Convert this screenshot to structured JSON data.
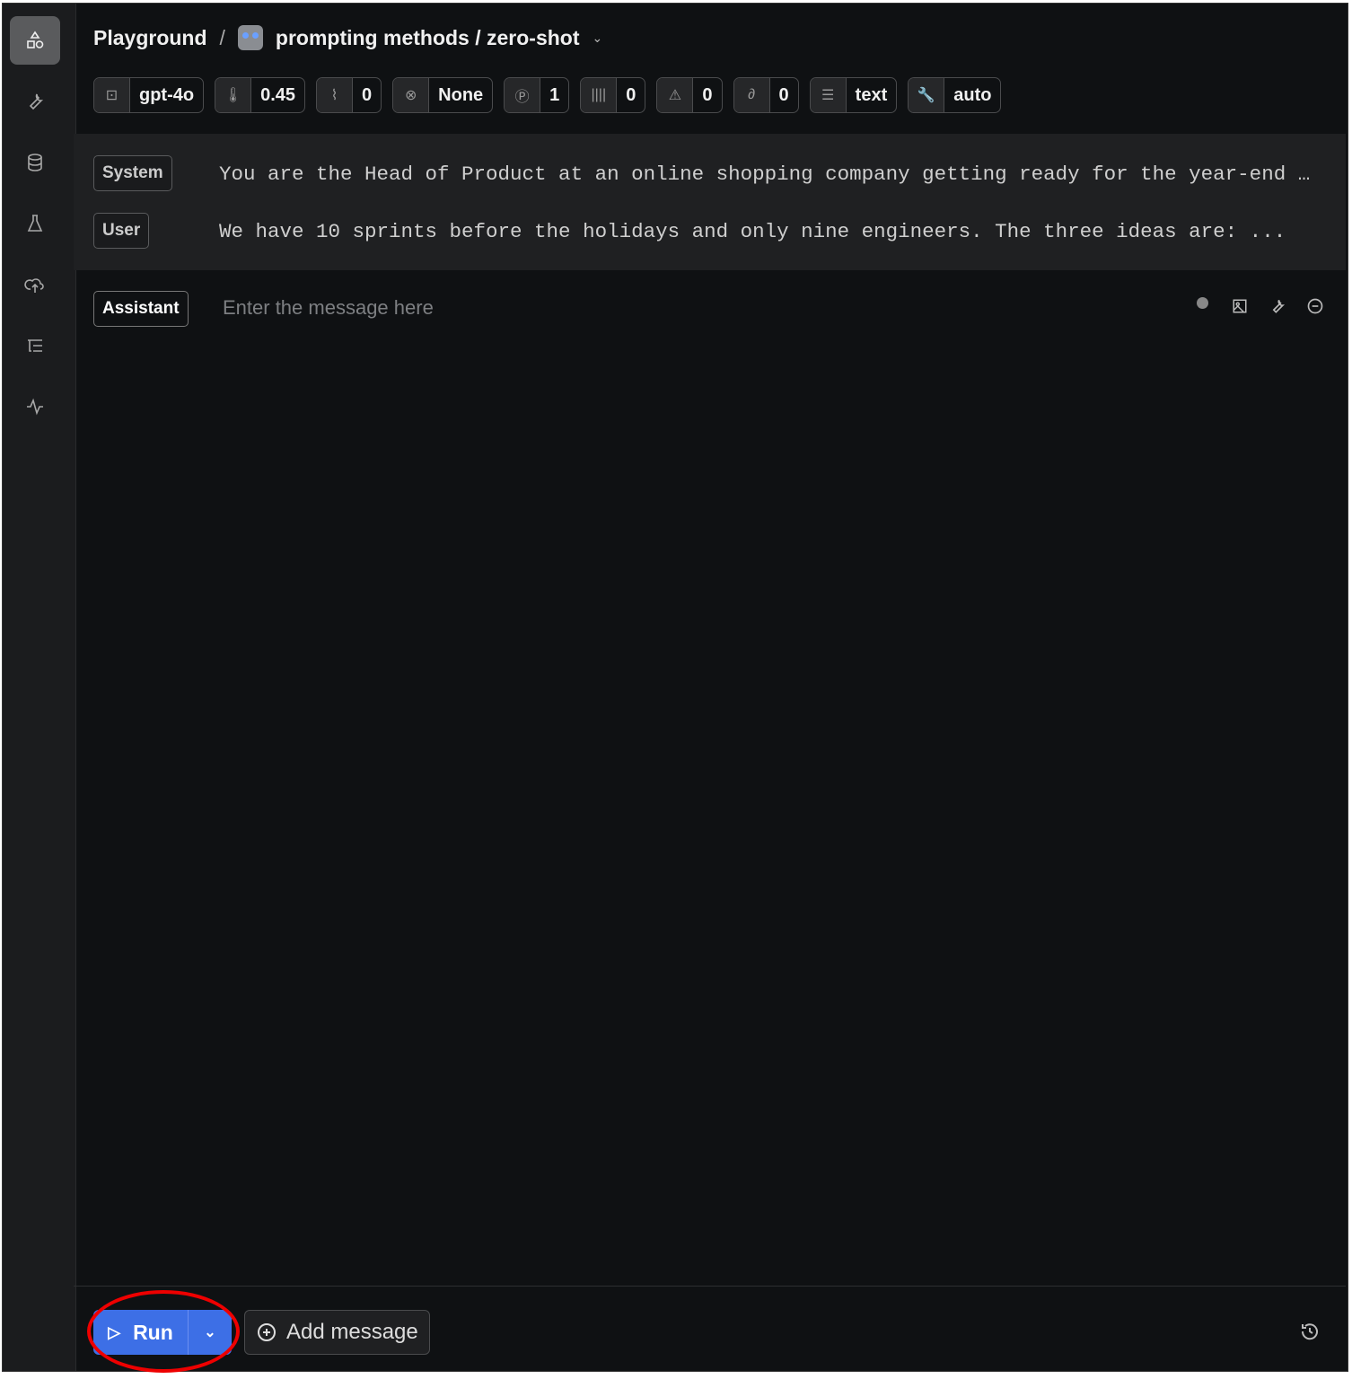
{
  "breadcrumb": {
    "root": "Playground",
    "separator": "/",
    "project": "prompting methods / zero-shot"
  },
  "params": [
    {
      "icon": "chip-icon",
      "glyph": "⊡",
      "value": "gpt-4o"
    },
    {
      "icon": "thermometer-icon",
      "glyph": "🌡",
      "value": "0.45"
    },
    {
      "icon": "paperclip-icon",
      "glyph": "⌇",
      "value": "0"
    },
    {
      "icon": "stop-icon",
      "glyph": "⊗",
      "value": "None"
    },
    {
      "icon": "p-circle-icon",
      "glyph": "Ⓟ",
      "value": "1"
    },
    {
      "icon": "bars-icon",
      "glyph": "||||",
      "value": "0"
    },
    {
      "icon": "siren-icon",
      "glyph": "⚠",
      "value": "0"
    },
    {
      "icon": "link-icon",
      "glyph": "∂",
      "value": "0"
    },
    {
      "icon": "format-icon",
      "glyph": "☰",
      "value": "text"
    },
    {
      "icon": "wrench-icon",
      "glyph": "🔧",
      "value": "auto"
    }
  ],
  "messages": [
    {
      "role": "System",
      "text": "You are the Head of Product at an online shopping company getting ready for the year-end holiday season"
    },
    {
      "role": "User",
      "text": "We have 10 sprints before the holidays and only nine engineers. The three ideas are: ..."
    }
  ],
  "assistant": {
    "role": "Assistant",
    "placeholder": "Enter the message here"
  },
  "footer": {
    "run": "Run",
    "add_message": "Add message"
  },
  "colors": {
    "accent": "#3d6fe6",
    "background": "#0f1113"
  }
}
